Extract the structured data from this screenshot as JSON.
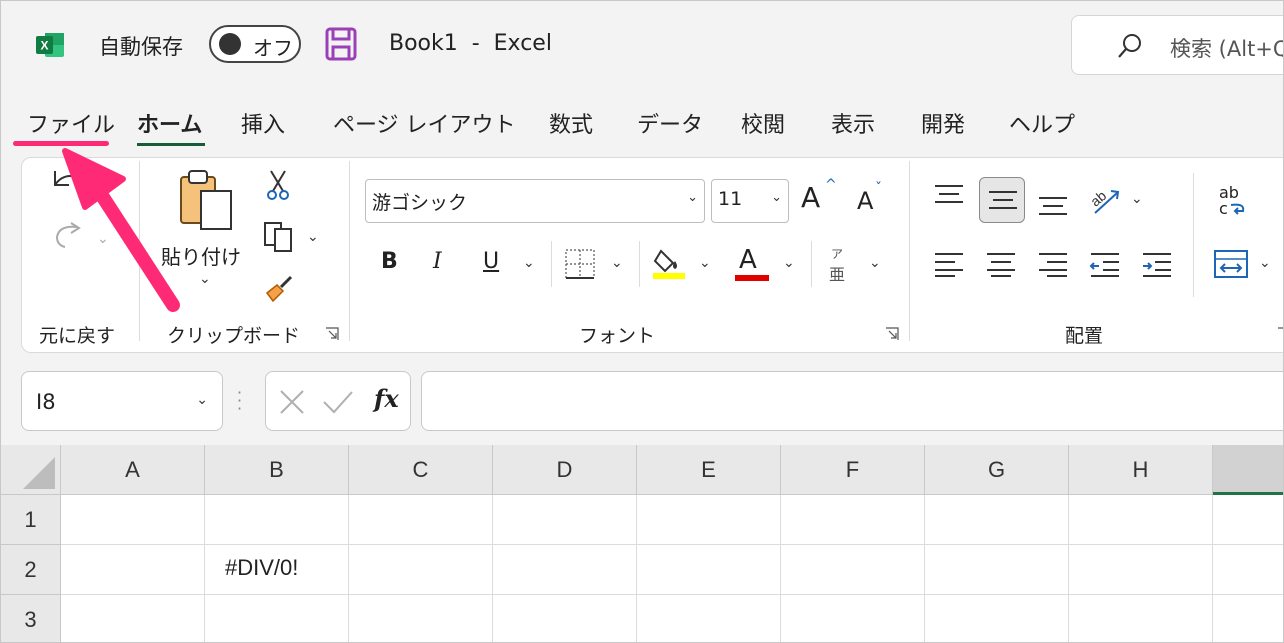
{
  "titlebar": {
    "autosave_label": "自動保存",
    "autosave_state": "オフ",
    "document_title": "Book1  -  Excel",
    "search_placeholder": "検索 (Alt+Q)",
    "logo_letter": "X",
    "brand_color": "#217346"
  },
  "tabs": {
    "items": [
      {
        "label": "ファイル"
      },
      {
        "label": "ホーム"
      },
      {
        "label": "挿入"
      },
      {
        "label": "ページ レイアウト"
      },
      {
        "label": "数式"
      },
      {
        "label": "データ"
      },
      {
        "label": "校閲"
      },
      {
        "label": "表示"
      },
      {
        "label": "開発"
      },
      {
        "label": "ヘルプ"
      }
    ],
    "active": "ホーム"
  },
  "ribbon": {
    "groups": {
      "undo": "元に戻す",
      "clipboard": "クリップボード",
      "font": "フォント",
      "alignment": "配置"
    },
    "paste_label": "貼り付け",
    "font_name": "游ゴシック",
    "font_size": "11",
    "bold": "B",
    "italic": "I",
    "underline": "U",
    "font_color_letter": "A",
    "grow_font": "A",
    "shrink_font": "A",
    "phonetic_top": "ア",
    "phonetic_bottom": "亜",
    "wrap_top": "ab",
    "wrap_bottom": "c",
    "fill_color": "#ffff00",
    "font_color": "#e00000"
  },
  "formula_bar": {
    "name_box": "I8",
    "fx": "fx",
    "formula": ""
  },
  "sheet": {
    "columns": [
      "A",
      "B",
      "C",
      "D",
      "E",
      "F",
      "G",
      "H",
      ""
    ],
    "rows": [
      "1",
      "2",
      "3"
    ],
    "cells": {
      "B2": "#DIV/0!"
    }
  },
  "annotation": {
    "arrow_color": "#ff2a76"
  }
}
